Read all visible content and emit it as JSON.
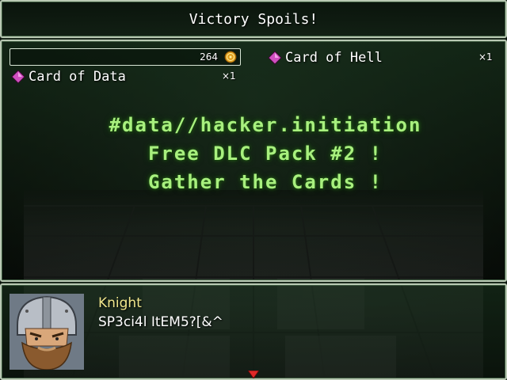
{
  "title": "Victory Spoils!",
  "gold": {
    "value": "264",
    "icon": "gold-coin-icon"
  },
  "items": [
    {
      "name": "Card of Hell",
      "count": "×1",
      "icon": "pink-gem-icon"
    },
    {
      "name": "Card of Data",
      "count": "×1",
      "icon": "pink-gem-icon"
    }
  ],
  "hacker_message": {
    "line1": "#data//hacker.initiation",
    "line2": "Free DLC Pack #2 !",
    "line3": "Gather the Cards !"
  },
  "dialogue": {
    "speaker": "Knight",
    "text": "SP3ci4l ItEM5?[&^"
  },
  "colors": {
    "window_border": "#b9c9b4",
    "hacker_text": "#a8f07e",
    "speaker_name": "#f0e68c",
    "gem": "#d04fc0",
    "coin": "#e0a020"
  }
}
